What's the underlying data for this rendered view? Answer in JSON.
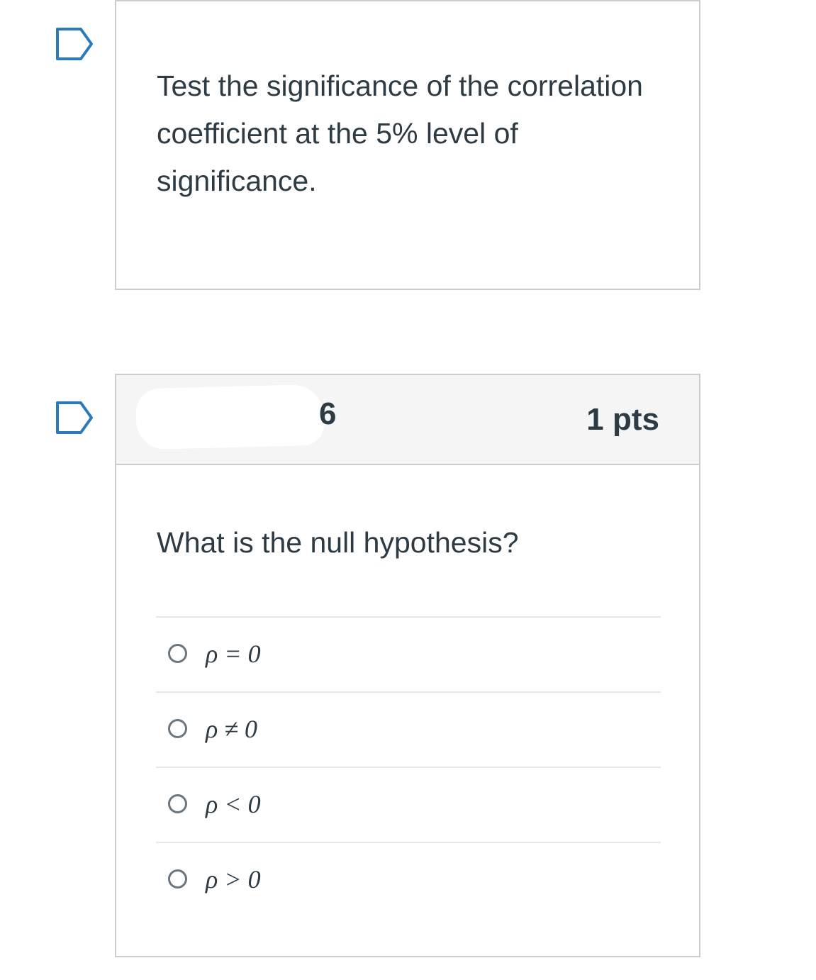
{
  "questions": [
    {
      "text": "Test the significance of the correlation coefficient at the 5% level of significance."
    },
    {
      "number": "6",
      "points": "1 pts",
      "prompt": "What is the null hypothesis?",
      "answers": [
        {
          "label": "ρ = 0"
        },
        {
          "label": "ρ ≠ 0"
        },
        {
          "label": "ρ < 0"
        },
        {
          "label": "ρ > 0"
        }
      ]
    }
  ],
  "colors": {
    "text": "#2d3b45",
    "border": "#c7cdd1",
    "header_bg": "#f5f5f5",
    "flag_stroke": "#2b7abc"
  },
  "icons": {
    "flag": "flag-question-icon",
    "radio": "radio-button-icon"
  }
}
